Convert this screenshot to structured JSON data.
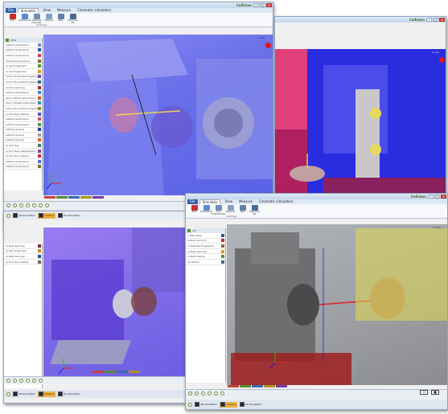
{
  "window1": {
    "title": "Collision",
    "menu": [
      "File",
      "Simulatio",
      "View",
      "Measure",
      "Cinematic simulation"
    ],
    "ribbon": [
      "Exit",
      "Additional",
      "Optimal Cylinder",
      "Options",
      "Nav",
      "Machine bit"
    ],
    "ribbon_group": "Sottilitge",
    "panel_header": "2x3L",
    "panel_items": [
      {
        "label": "Lifshell (solac/zero)",
        "color": "#6a8cd0"
      },
      {
        "label": "Lifshell (solac/zero)",
        "color": "#3050b0"
      },
      {
        "label": "Lifshell (solac/zero)",
        "color": "#c84060"
      },
      {
        "label": "2Lifshell (solac/zero)",
        "color": "#8a6a30"
      },
      {
        "label": "1) Gaching(zolar)",
        "color": "#5e9040"
      },
      {
        "label": "1) Gaching(zolar)",
        "color": "#d0a020"
      },
      {
        "label": "1(3)d (face Prefoming(zolar))",
        "color": "#7050a0"
      },
      {
        "label": "1(3)d (face Prefoming(zolar))",
        "color": "#3a6a8a"
      },
      {
        "label": "1(7)(1) Gaching",
        "color": "#a03030"
      },
      {
        "label": "Lifshell (solac/zero)",
        "color": "#4d7fc0"
      },
      {
        "label": "(6(1) Lifshell (solac/zero)",
        "color": "#c06020"
      },
      {
        "label": "(3)(1) Lifshell (solac/zero)",
        "color": "#3090a0"
      },
      {
        "label": "1(3)d (face Prefoming(zolar))",
        "color": "#8a8a30"
      },
      {
        "label": "1) End face Lifshell",
        "color": "#6050c0"
      },
      {
        "label": "Lifshell (solac/zero)",
        "color": "#c05080"
      },
      {
        "label": "Lifshell (solac/zero)",
        "color": "#4a9a4a"
      },
      {
        "label": "Lifshell (solac2)",
        "color": "#2040a0"
      },
      {
        "label": "Lifshell (solac2)",
        "color": "#a0a0a0"
      },
      {
        "label": "Lifshell (solac2)",
        "color": "#d07030"
      },
      {
        "label": "1) Gaching",
        "color": "#408070"
      },
      {
        "label": "1) End face Lifshell(zero)",
        "color": "#9040a0"
      },
      {
        "label": "1) End face Lifshell",
        "color": "#c03040"
      },
      {
        "label": "Lifshell (solac/zero)",
        "color": "#5070d0"
      },
      {
        "label": "Lifshell (solac/zero)",
        "color": "#707030"
      }
    ],
    "version": "2.0 0s"
  },
  "window2": {
    "title": "Collision",
    "version": "2.0 0s"
  },
  "window3": {
    "tabs": [
      "2D Simulation",
      "Collision",
      "2D Simulation"
    ],
    "panel_items": [
      {
        "label": "1) Batt Gaching",
        "color": "#7a3030"
      },
      {
        "label": "1) Gaching(zolar)",
        "color": "#c89020"
      },
      {
        "label": "1) Batt Gaching",
        "color": "#2d5090"
      },
      {
        "label": "1) End face Lifshell",
        "color": "#6a6a6a"
      }
    ]
  },
  "window4": {
    "title": "Collision",
    "menu": [
      "File",
      "Simulatio",
      "View",
      "Measure",
      "Cinematic simulation"
    ],
    "ribbon": [
      "Exit",
      "Additional",
      "T-Gr TOOLfindler",
      "Options",
      "Nav",
      "Machine bit"
    ],
    "ribbon_group": "Sottilitge",
    "panel_header": "2.0",
    "panel_items": [
      {
        "label": "1 Main Pode",
        "color": "#3050a0"
      },
      {
        "label": "Lifshell (around)",
        "color": "#c03040"
      },
      {
        "label": "1) Batt Gaching(zolar)",
        "color": "#8a6a30"
      },
      {
        "label": "1) Batt Gaching",
        "color": "#d0a020"
      },
      {
        "label": "1) Batt Lifshell",
        "color": "#5e9040"
      },
      {
        "label": "1) Lifshell",
        "color": "#3a6a8a"
      }
    ],
    "tabs": [
      "2D Simulation",
      "Collision",
      "2D Simulation"
    ],
    "version": "2.0 0s"
  },
  "icons": {
    "play": "play-icon",
    "stop": "stop-icon",
    "collision": "collision-indicator-icon"
  },
  "colors": {
    "ribbon_accent": "#2d5fa8",
    "active_tab": "#f0b040",
    "collision_red": "#e01818",
    "viewport_blue": "#5a63e8"
  }
}
